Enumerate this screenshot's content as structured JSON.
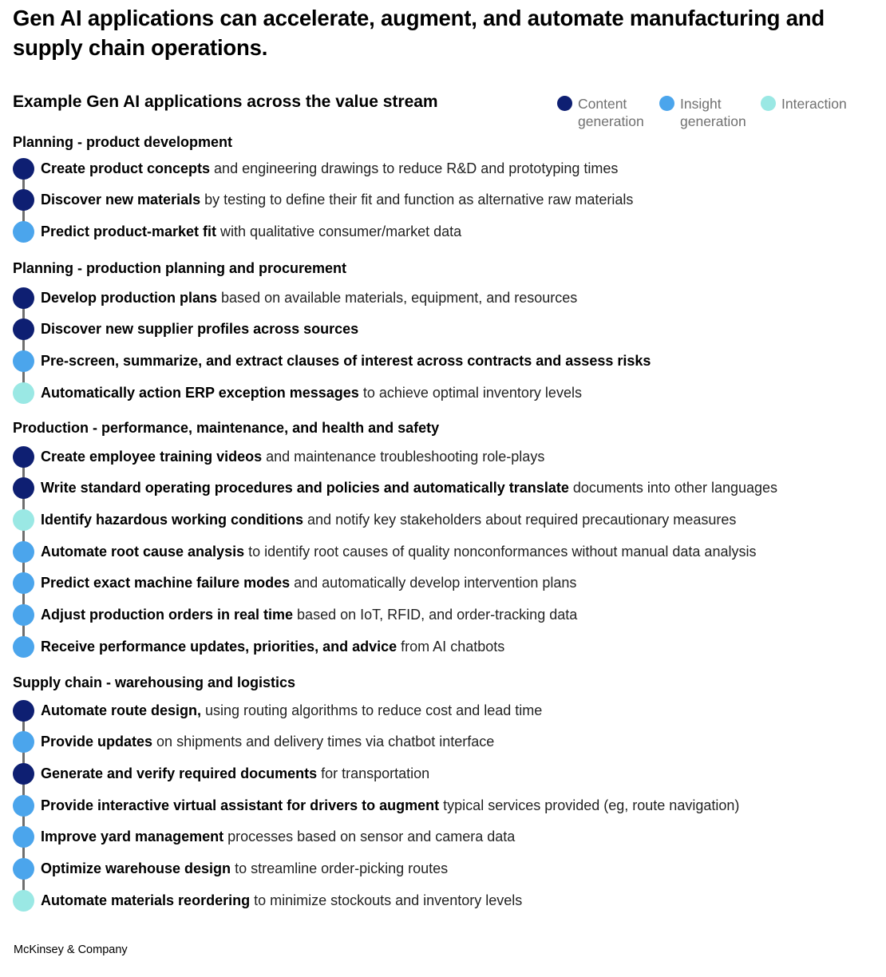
{
  "title": "Gen AI applications can accelerate, augment, and automate manufacturing and supply chain operations.",
  "subtitle": "Example Gen AI applications across the value stream",
  "colors": {
    "content": "#0e1f72",
    "insight": "#4ba5ec",
    "interaction": "#9ae8e4",
    "connector": "#6f6f6f"
  },
  "legend": [
    {
      "key": "content",
      "label": "Content\ngeneration"
    },
    {
      "key": "insight",
      "label": "Insight\ngeneration"
    },
    {
      "key": "interaction",
      "label": "Interaction"
    }
  ],
  "sections": [
    {
      "title": "Planning - product development",
      "items": [
        {
          "type": "content",
          "bold": "Create product concepts",
          "rest": " and engineering drawings to reduce R&D and prototyping times"
        },
        {
          "type": "content",
          "bold": "Discover new materials",
          "rest": " by testing to define their fit and function as alternative raw materials"
        },
        {
          "type": "insight",
          "bold": "Predict product-market fit",
          "rest": " with qualitative consumer/market data"
        }
      ]
    },
    {
      "title": "Planning - production planning and procurement",
      "items": [
        {
          "type": "content",
          "bold": "Develop production plans",
          "rest": " based on available materials, equipment, and resources"
        },
        {
          "type": "content",
          "bold": "Discover new supplier profiles across sources",
          "rest": ""
        },
        {
          "type": "insight",
          "bold": "Pre-screen, summarize, and extract clauses of interest across contracts and assess risks",
          "rest": ""
        },
        {
          "type": "interaction",
          "bold": "Automatically action ERP exception messages",
          "rest": " to achieve optimal inventory levels"
        }
      ]
    },
    {
      "title": "Production - performance, maintenance, and health and safety",
      "items": [
        {
          "type": "content",
          "bold": "Create employee training videos",
          "rest": " and maintenance troubleshooting role-plays"
        },
        {
          "type": "content",
          "bold": "Write standard operating procedures and policies and automatically translate",
          "rest": " documents into other languages"
        },
        {
          "type": "interaction",
          "bold": "Identify hazardous working conditions",
          "rest": " and notify key stakeholders about required precautionary measures"
        },
        {
          "type": "insight",
          "bold": "Automate root cause analysis",
          "rest": " to identify root causes of quality nonconformances without manual data analysis"
        },
        {
          "type": "insight",
          "bold": "Predict exact machine failure modes",
          "rest": " and automatically develop intervention plans"
        },
        {
          "type": "insight",
          "bold": "Adjust production orders in real time",
          "rest": " based on IoT, RFID, and order-tracking data"
        },
        {
          "type": "insight",
          "bold": "Receive performance updates, priorities, and advice",
          "rest": " from AI chatbots"
        }
      ]
    },
    {
      "title": "Supply chain - warehousing and logistics",
      "items": [
        {
          "type": "content",
          "bold": "Automate route design,",
          "rest": " using routing algorithms to reduce cost and lead time"
        },
        {
          "type": "insight",
          "bold": "Provide updates",
          "rest": " on shipments and delivery times via chatbot interface"
        },
        {
          "type": "content",
          "bold": "Generate and verify required documents",
          "rest": " for transportation"
        },
        {
          "type": "insight",
          "bold": "Provide interactive virtual assistant for drivers to augment",
          "rest": " typical services provided (eg, route navigation)"
        },
        {
          "type": "insight",
          "bold": "Improve yard management",
          "rest": " processes based on sensor and camera data"
        },
        {
          "type": "insight",
          "bold": "Optimize warehouse design",
          "rest": " to streamline order-picking routes"
        },
        {
          "type": "interaction",
          "bold": "Automate materials reordering",
          "rest": " to minimize stockouts and inventory levels"
        }
      ]
    }
  ],
  "footer": "McKinsey & Company"
}
